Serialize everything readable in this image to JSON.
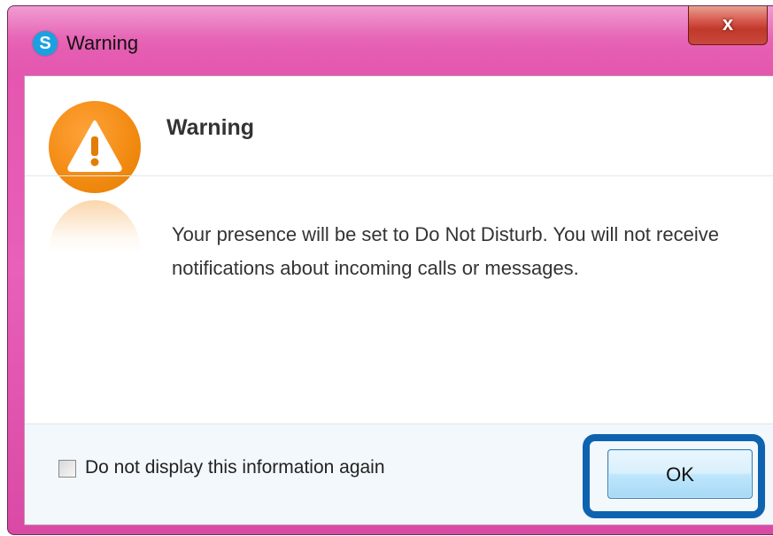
{
  "window": {
    "title": "Warning",
    "app_icon_letter": "S",
    "close_label": "x"
  },
  "dialog": {
    "heading": "Warning",
    "message": "Your presence will be set to Do Not Disturb. You will not receive notifications about incoming calls or messages.",
    "warning_icon": "warning-triangle-icon"
  },
  "footer": {
    "checkbox_label": "Do not display this information again",
    "checkbox_checked": false,
    "ok_label": "OK"
  },
  "colors": {
    "title_bar": "#e455ae",
    "close_button": "#c9483c",
    "warning_icon": "#f28a10",
    "highlight_border": "#0e63b0",
    "ok_button": "#bee6fd"
  }
}
